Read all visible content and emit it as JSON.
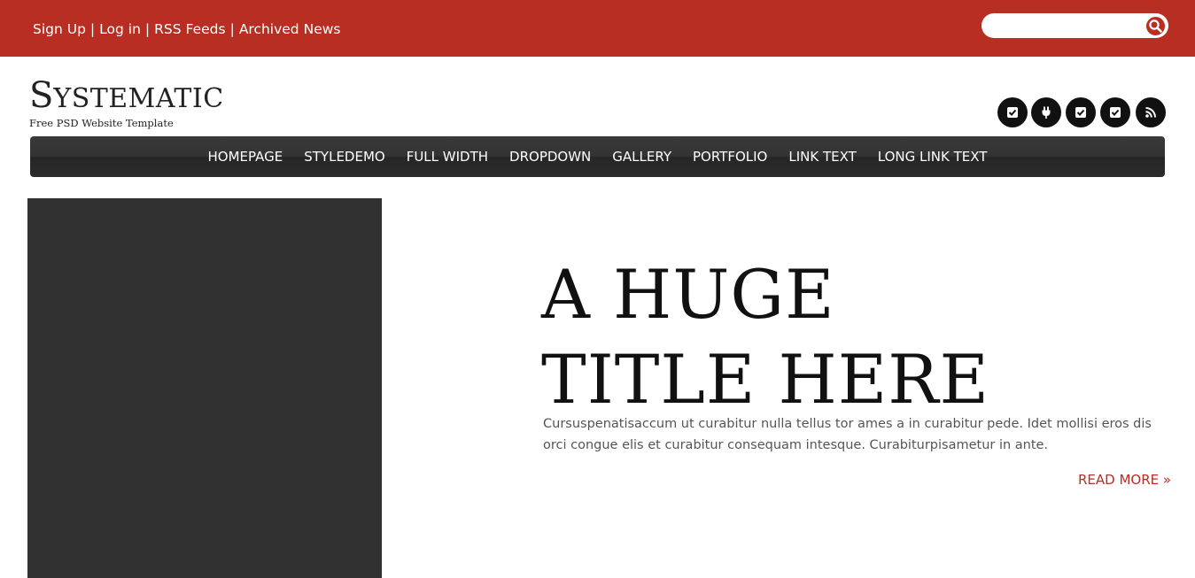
{
  "topbar": {
    "links": [
      "Sign Up",
      "Log in",
      "RSS Feeds",
      "Archived News"
    ],
    "separator": "|",
    "search": {
      "placeholder": "",
      "value": ""
    }
  },
  "header": {
    "logo_first": "S",
    "logo_rest": "YSTEMATIC",
    "tagline": "Free PSD Website Template",
    "social_icons": [
      "check-square-icon",
      "plug-icon",
      "check-square-icon",
      "check-square-icon",
      "rss-icon"
    ]
  },
  "nav": {
    "items": [
      "HOMEPAGE",
      "STYLEDEMO",
      "FULL WIDTH",
      "DROPDOWN",
      "GALLERY",
      "PORTFOLIO",
      "LINK TEXT",
      "LONG LINK TEXT"
    ]
  },
  "hero": {
    "title_line1": "A HUGE",
    "title_line2": "TITLE HERE",
    "text": "Cursuspenatisaccum ut curabitur nulla tellus tor ames a in curabitur pede. Idet mollisi eros dis orci congue elis et curabitur consequam intesque. Curabiturpisametur in ante.",
    "read_more": "READ MORE »"
  },
  "colors": {
    "accent": "#b92e22",
    "nav_bg": "#2e2e2e",
    "hero_image": "#313131"
  }
}
